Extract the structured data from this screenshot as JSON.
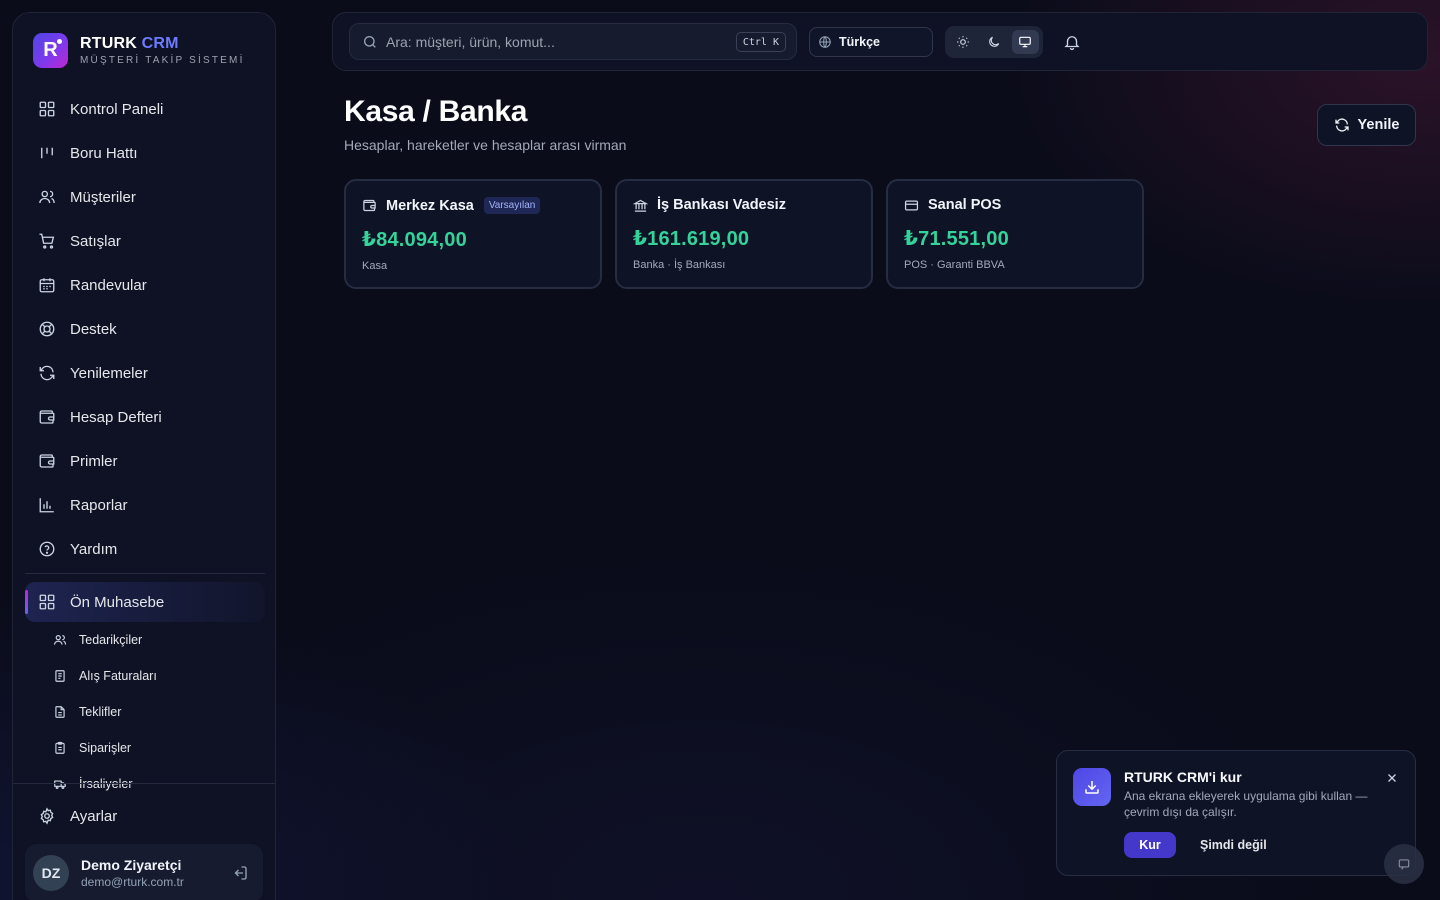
{
  "brand": {
    "name": "RTURK",
    "name_accent": "CRM",
    "subtitle": "MÜŞTERİ TAKİP SİSTEMİ",
    "logo_letter": "R"
  },
  "nav": {
    "items": [
      {
        "label": "Kontrol Paneli",
        "icon": "grid-icon"
      },
      {
        "label": "Boru Hattı",
        "icon": "pipeline-icon"
      },
      {
        "label": "Müşteriler",
        "icon": "users-icon"
      },
      {
        "label": "Satışlar",
        "icon": "cart-icon"
      },
      {
        "label": "Randevular",
        "icon": "calendar-icon"
      },
      {
        "label": "Destek",
        "icon": "lifebuoy-icon"
      },
      {
        "label": "Yenilemeler",
        "icon": "refresh-icon"
      },
      {
        "label": "Hesap Defteri",
        "icon": "wallet-icon"
      },
      {
        "label": "Primler",
        "icon": "wallet-icon"
      },
      {
        "label": "Raporlar",
        "icon": "bar-chart-icon"
      },
      {
        "label": "Yardım",
        "icon": "help-icon"
      }
    ],
    "active": {
      "label": "Ön Muhasebe",
      "icon": "grid-icon"
    },
    "sub_items": [
      {
        "label": "Tedarikçiler",
        "icon": "users-icon"
      },
      {
        "label": "Alış Faturaları",
        "icon": "document-icon"
      },
      {
        "label": "Teklifler",
        "icon": "document-icon"
      },
      {
        "label": "Siparişler",
        "icon": "clipboard-icon"
      },
      {
        "label": "İrsaliyeler",
        "icon": "truck-icon"
      }
    ],
    "settings": "Ayarlar"
  },
  "user": {
    "initials": "DZ",
    "name": "Demo Ziyaretçi",
    "email": "demo@rturk.com.tr"
  },
  "topbar": {
    "search_placeholder": "Ara: müşteri, ürün, komut...",
    "shortcut": "Ctrl K",
    "language": "Türkçe",
    "theme_selected": "system"
  },
  "page": {
    "title": "Kasa / Banka",
    "subtitle": "Hesaplar, hareketler ve hesaplar arası virman",
    "refresh_label": "Yenile"
  },
  "accounts": [
    {
      "name": "Merkez Kasa",
      "badge": "Varsayılan",
      "balance": "₺84.094,00",
      "meta": "Kasa",
      "icon": "wallet-icon"
    },
    {
      "name": "İş Bankası Vadesiz",
      "badge": "",
      "balance": "₺161.619,00",
      "meta": "Banka · İş Bankası",
      "icon": "bank-icon"
    },
    {
      "name": "Sanal POS",
      "badge": "",
      "balance": "₺71.551,00",
      "meta": "POS · Garanti BBVA",
      "icon": "credit-card-icon"
    }
  ],
  "install": {
    "title": "RTURK CRM'i kur",
    "body": "Ana ekrana ekleyerek uygulama gibi kullan — çevrim dışı da çalışır.",
    "install_label": "Kur",
    "later_label": "Şimdi değil"
  },
  "colors": {
    "accent": "#4f46e5",
    "balance": "#34d399",
    "background": "#0a0c1a"
  }
}
